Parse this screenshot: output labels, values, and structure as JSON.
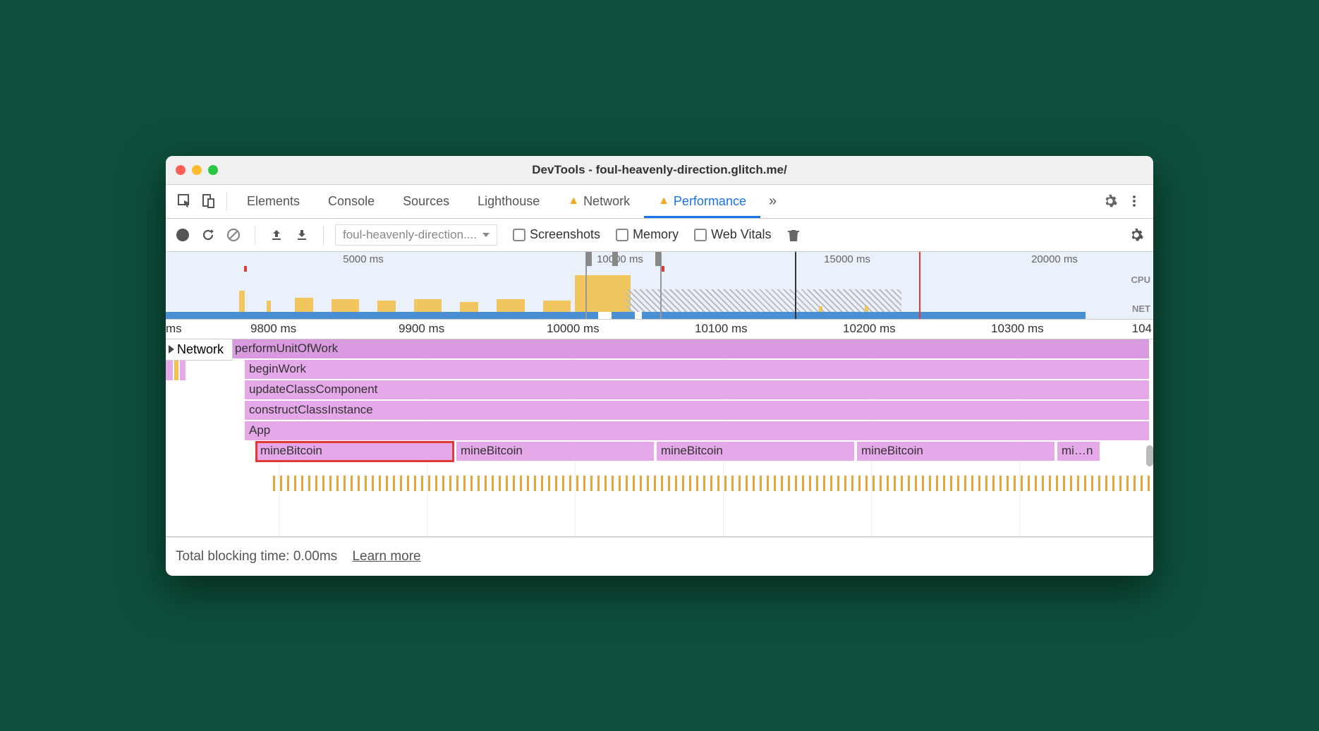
{
  "window": {
    "title": "DevTools - foul-heavenly-direction.glitch.me/"
  },
  "tabs": {
    "elements": "Elements",
    "console": "Console",
    "sources": "Sources",
    "lighthouse": "Lighthouse",
    "network": "Network",
    "performance": "Performance"
  },
  "toolbar": {
    "select_label": "foul-heavenly-direction....",
    "screenshots": "Screenshots",
    "memory": "Memory",
    "webvitals": "Web Vitals"
  },
  "overview_ticks": {
    "t1": "5000 ms",
    "t2": "10000 ms",
    "t3": "15000 ms",
    "t4": "20000 ms"
  },
  "overview_labels": {
    "cpu": "CPU",
    "net": "NET"
  },
  "ruler": {
    "r0": "ms",
    "r1": "9800 ms",
    "r2": "9900 ms",
    "r3": "10000 ms",
    "r4": "10100 ms",
    "r5": "10200 ms",
    "r6": "10300 ms",
    "r7": "104"
  },
  "network_section": "Network",
  "flame": {
    "performUnitOfWork": "performUnitOfWork",
    "beginWork": "beginWork",
    "updateClassComponent": "updateClassComponent",
    "constructClassInstance": "constructClassInstance",
    "app": "App",
    "mb1": "mineBitcoin",
    "mb2": "mineBitcoin",
    "mb3": "mineBitcoin",
    "mb4": "mineBitcoin",
    "mb5": "mi…n"
  },
  "footer": {
    "tbt": "Total blocking time: 0.00ms",
    "learn_more": "Learn more"
  }
}
